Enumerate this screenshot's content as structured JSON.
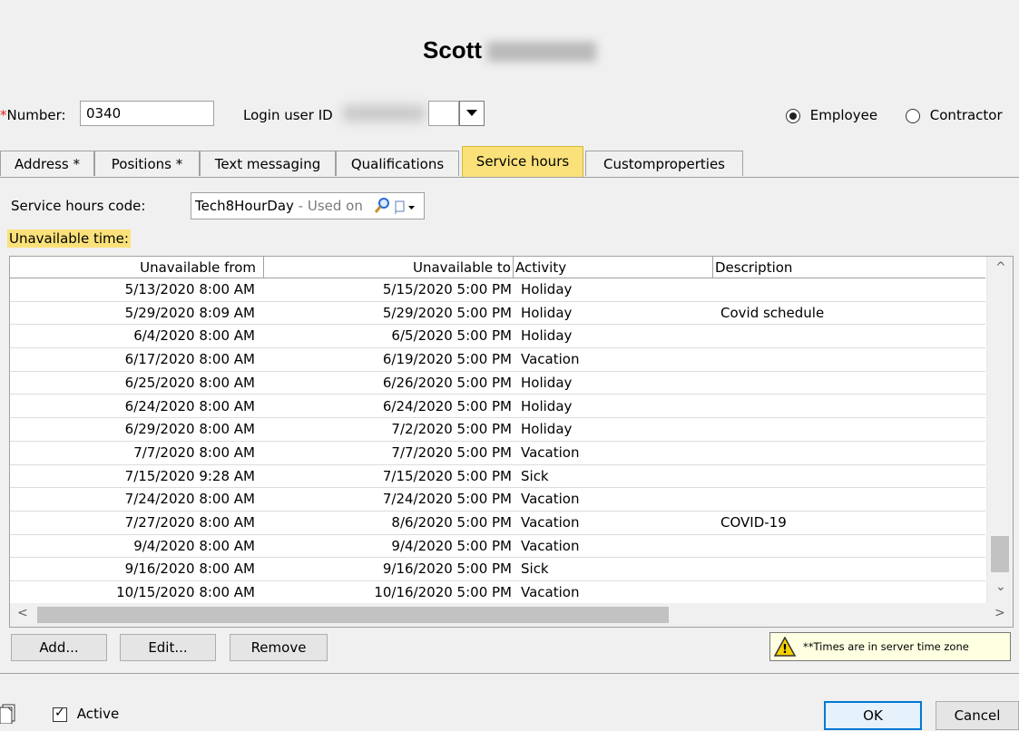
{
  "header": {
    "first_name": "Scott"
  },
  "fields": {
    "number_label": "Number:",
    "number_required_mark": "*",
    "number_value": "0340",
    "login_label": "Login user ID",
    "type_options": [
      {
        "label": "Employee",
        "checked": true
      },
      {
        "label": "Contractor",
        "checked": false
      }
    ]
  },
  "tabs": [
    {
      "label": "Address *",
      "active": false
    },
    {
      "label": "Positions *",
      "active": false
    },
    {
      "label": "Text messaging",
      "active": false
    },
    {
      "label": "Qualifications",
      "active": false
    },
    {
      "label": "Service hours",
      "active": true
    },
    {
      "label": "Customproperties",
      "active": false
    }
  ],
  "service_hours": {
    "code_label": "Service hours code:",
    "code_value": "Tech8HourDay",
    "code_suffix": " - Used on",
    "unavailable_label": "Unavailable time:"
  },
  "table": {
    "columns": [
      "Unavailable from",
      "Unavailable to",
      "Activity",
      "Description"
    ],
    "rows": [
      [
        "5/13/2020 8:00 AM",
        "5/15/2020 5:00 PM",
        "Holiday",
        ""
      ],
      [
        "5/29/2020 8:09 AM",
        "5/29/2020 5:00 PM",
        "Holiday",
        "Covid schedule"
      ],
      [
        "6/4/2020 8:00 AM",
        "6/5/2020 5:00 PM",
        "Holiday",
        ""
      ],
      [
        "6/17/2020 8:00 AM",
        "6/19/2020 5:00 PM",
        "Vacation",
        ""
      ],
      [
        "6/25/2020 8:00 AM",
        "6/26/2020 5:00 PM",
        "Holiday",
        ""
      ],
      [
        "6/24/2020 8:00 AM",
        "6/24/2020 5:00 PM",
        "Holiday",
        ""
      ],
      [
        "6/29/2020 8:00 AM",
        "7/2/2020 5:00 PM",
        "Holiday",
        ""
      ],
      [
        "7/7/2020 8:00 AM",
        "7/7/2020 5:00 PM",
        "Vacation",
        ""
      ],
      [
        "7/15/2020 9:28 AM",
        "7/15/2020 5:00 PM",
        "Sick",
        ""
      ],
      [
        "7/24/2020 8:00 AM",
        "7/24/2020 5:00 PM",
        "Vacation",
        ""
      ],
      [
        "7/27/2020 8:00 AM",
        "8/6/2020 5:00 PM",
        "Vacation",
        "COVID-19"
      ],
      [
        "9/4/2020 8:00 AM",
        "9/4/2020 5:00 PM",
        "Vacation",
        ""
      ],
      [
        "9/16/2020 8:00 AM",
        "9/16/2020 5:00 PM",
        "Sick",
        ""
      ],
      [
        "10/15/2020 8:00 AM",
        "10/16/2020 5:00 PM",
        "Vacation",
        ""
      ]
    ]
  },
  "actions": {
    "add_label": "Add...",
    "edit_label": "Edit...",
    "remove_label": "Remove",
    "timezone_note": "**Times are in server time zone"
  },
  "footer": {
    "active_label": "Active",
    "active_checked": true,
    "ok_label": "OK",
    "cancel_label": "Cancel"
  },
  "colors": {
    "highlight": "#fbe17a",
    "primary_border": "#0078d7",
    "warning": "#f5d200"
  },
  "icons": [
    "search-icon",
    "flag-dropdown-icon",
    "warning-icon",
    "document-icon",
    "dropdown-arrow-icon"
  ]
}
